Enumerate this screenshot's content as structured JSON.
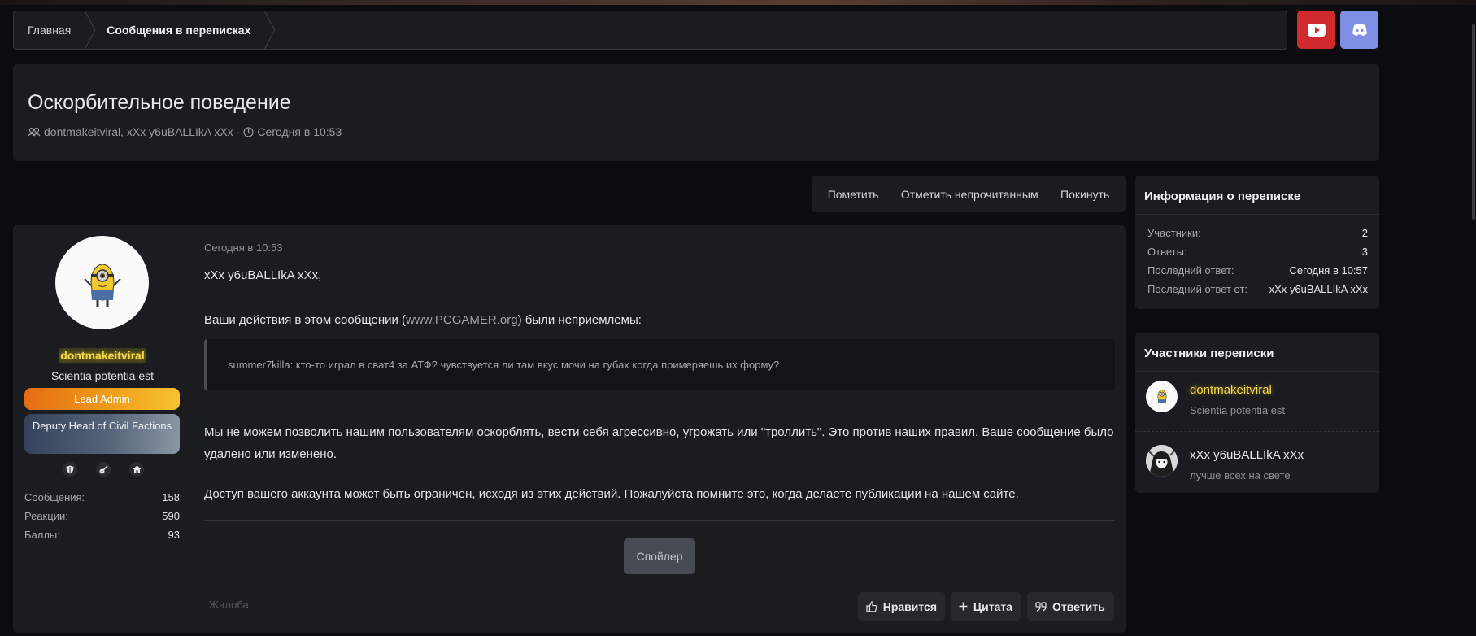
{
  "breadcrumb": {
    "items": [
      "Главная",
      "Сообщения в переписках"
    ]
  },
  "social": {
    "youtube_color": "#d12a2e",
    "discord_color": "#7f8fe3",
    "youtube_icon": "youtube-icon",
    "discord_icon": "discord-icon"
  },
  "conversation": {
    "title": "Оскорбительное поведение",
    "participants_line": "dontmakeitviral, xXx у6uBALLIkA xXx",
    "separator": "·",
    "date": "Сегодня в 10:53"
  },
  "actions": {
    "mark": "Пометить",
    "mark_unread": "Отметить непрочитанным",
    "leave": "Покинуть"
  },
  "author": {
    "name": "dontmakeitviral",
    "title": "Scientia potentia est",
    "banner1": "Lead Admin",
    "banner2": "Deputy Head of Civil Factions",
    "stats": [
      {
        "label": "Сообщения:",
        "value": "158"
      },
      {
        "label": "Реакции:",
        "value": "590"
      },
      {
        "label": "Баллы:",
        "value": "93"
      }
    ]
  },
  "message": {
    "date": "Сегодня в 10:53",
    "greeting": "xXx у6uBALLIkA xXx,",
    "p2_before": "Ваши действия в этом сообщении (",
    "p2_link": "www.PCGAMER.org",
    "p2_after": ") были неприемлемы:",
    "quote": "summer7killa: кто-то играл в сват4 за АТФ? чувствуется ли там вкус мочи на губах когда примеряешь их форму?",
    "p3": "Мы не можем позволить нашим пользователям оскорблять, вести себя агрессивно, угрожать или \"троллить\". Это против наших правил. Ваше сообщение было удалено или изменено.",
    "p4": "Доступ вашего аккаунта может быть ограничен, исходя из этих действий. Пожалуйста помните это, когда делаете публикации на нашем сайте.",
    "spoiler": "Спойлер",
    "report": "Жалоба",
    "like": "Нравится",
    "quote_btn": "Цитата",
    "reply": "Ответить"
  },
  "info_panel": {
    "title": "Информация о переписке",
    "rows": [
      {
        "label": "Участники:",
        "value": "2"
      },
      {
        "label": "Ответы:",
        "value": "3"
      },
      {
        "label": "Последний ответ:",
        "value": "Сегодня в 10:57"
      },
      {
        "label": "Последний ответ от:",
        "value": "xXx у6uBALLIkA xXx"
      }
    ]
  },
  "members_panel": {
    "title": "Участники переписки",
    "members": [
      {
        "name": "dontmakeitviral",
        "status": "Scientia potentia est"
      },
      {
        "name": "xXx у6uBALLIkA xXx",
        "status": "лучше всех на свете"
      }
    ]
  }
}
